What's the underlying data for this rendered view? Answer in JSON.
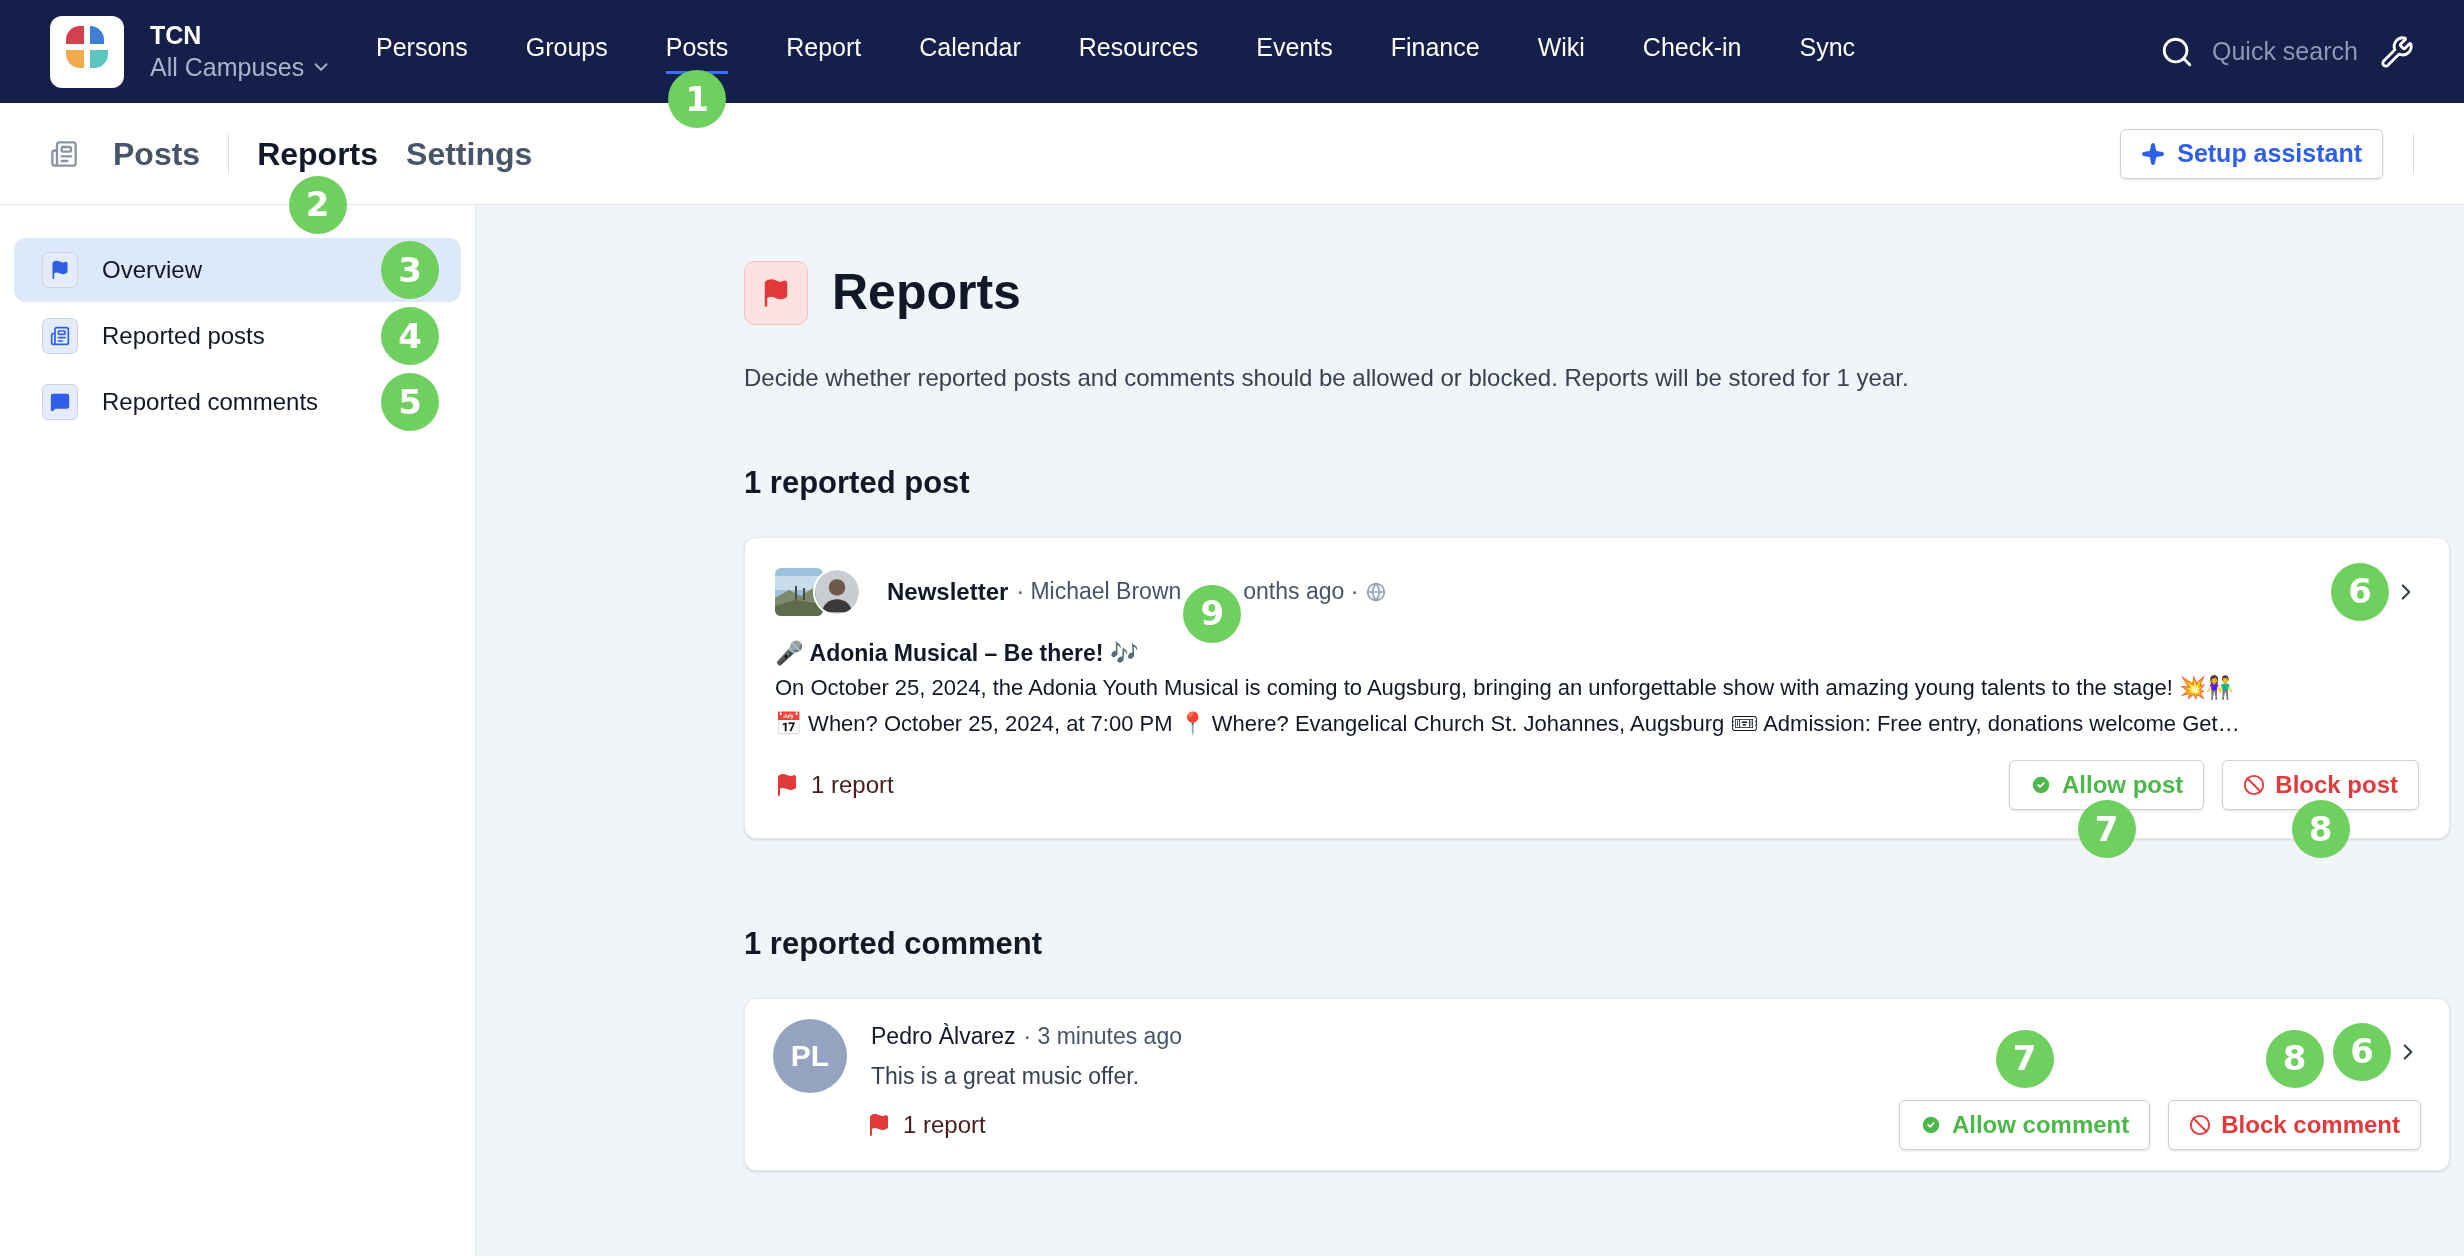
{
  "app": {
    "name": "TCN",
    "scope": "All Campuses"
  },
  "nav": [
    {
      "label": "Persons",
      "selected": false
    },
    {
      "label": "Groups",
      "selected": false
    },
    {
      "label": "Posts",
      "selected": true,
      "callout": "1"
    },
    {
      "label": "Report",
      "selected": false
    },
    {
      "label": "Calendar",
      "selected": false
    },
    {
      "label": "Resources",
      "selected": false
    },
    {
      "label": "Events",
      "selected": false
    },
    {
      "label": "Finance",
      "selected": false
    },
    {
      "label": "Wiki",
      "selected": false
    },
    {
      "label": "Check-in",
      "selected": false
    },
    {
      "label": "Sync",
      "selected": false
    }
  ],
  "search": {
    "placeholder": "Quick search"
  },
  "subnav": {
    "section": "Posts",
    "tabs": [
      {
        "label": "Reports",
        "selected": true,
        "callout": "2"
      },
      {
        "label": "Settings",
        "selected": false
      }
    ],
    "action": "Setup assistant"
  },
  "sidebar": [
    {
      "kind": "flag",
      "label": "Overview",
      "selected": true,
      "callout": "3"
    },
    {
      "kind": "posts",
      "label": "Reported posts",
      "selected": false,
      "callout": "4"
    },
    {
      "kind": "comments",
      "label": "Reported comments",
      "selected": false,
      "callout": "5"
    }
  ],
  "page": {
    "title": "Reports",
    "description": "Decide whether reported posts and comments should be allowed or blocked. Reports will be stored for 1 year."
  },
  "posts_section": {
    "heading": "1 reported post",
    "items": [
      {
        "group": "Newsletter",
        "author": "· Michael Brown",
        "meta_callout": "9",
        "time": "onths ago ·",
        "title": "🎤 Adonia Musical – Be there! 🎶",
        "body_lines": [
          "On October 25, 2024, the Adonia Youth Musical is coming to Augsburg, bringing an unforgettable show with amazing young talents to the stage! 💥👫",
          "📅 When? October 25, 2024, at 7:00 PM 📍 Where? Evangelical Church St. Johannes, Augsburg 🎟 Admission: Free entry, donations welcome Get…"
        ],
        "reports": "1 report",
        "chevron_callout": "6",
        "allow": {
          "label": "Allow post",
          "callout": "7"
        },
        "block": {
          "label": "Block post",
          "callout": "8"
        }
      }
    ]
  },
  "comments_section": {
    "heading": "1 reported comment",
    "items": [
      {
        "initials": "PL",
        "author": "Pedro Àlvarez",
        "time": "· 3 minutes ago",
        "text": "This is a great music offer.",
        "reports": "1 report",
        "chevron_callout": "6",
        "allow": {
          "label": "Allow comment",
          "callout": "7"
        },
        "block": {
          "label": "Block comment",
          "callout": "8"
        }
      }
    ]
  }
}
